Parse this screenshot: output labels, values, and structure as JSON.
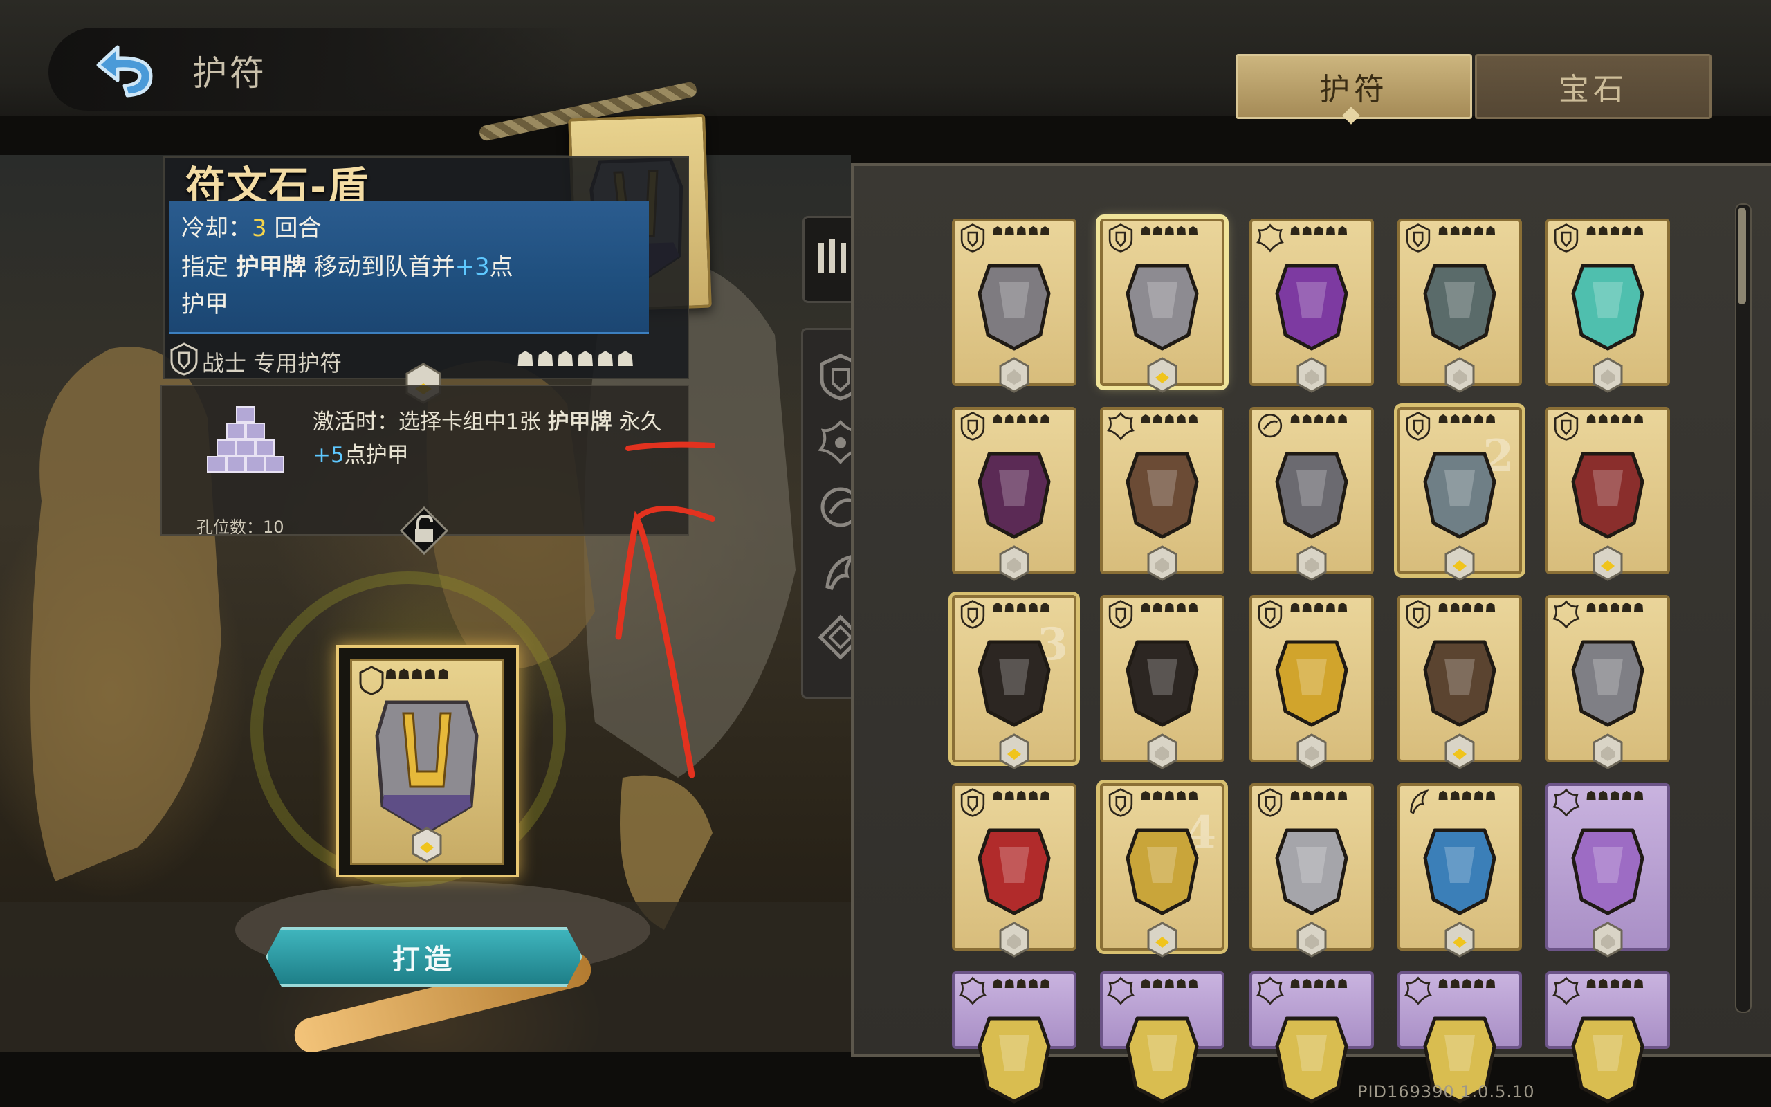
{
  "header": {
    "title": "护符",
    "tabs": [
      {
        "label": "护符",
        "active": true
      },
      {
        "label": "宝石",
        "active": false
      }
    ]
  },
  "detail": {
    "name": "符文石-盾",
    "cooldown_prefix": "冷却：",
    "cooldown_value": "3",
    "cooldown_suffix": "回合",
    "effect_line1_a": "指定",
    "effect_line1_b": "护甲牌",
    "effect_line1_c": "移动到队首并",
    "effect_line1_d": "+3",
    "effect_line1_e": "点",
    "effect_line2": "护甲",
    "class_label": "战士 专用护符",
    "rank_stars": "☗☗☗☗☗☗",
    "slot_text1_a": "激活时：选择卡组中1张",
    "slot_text1_b": "护甲牌",
    "slot_text1_c": "永久",
    "slot_text2_a": "+5",
    "slot_text2_b": "点护甲",
    "slot_count": "孔位数：10"
  },
  "forge": {
    "button_label": "打造",
    "card_stars": "☗☗☗☗☗"
  },
  "filters": [
    "sort",
    "warrior",
    "mage",
    "rogue",
    "poet",
    "hunter"
  ],
  "grid": {
    "card_stars": "☗☗☗☗☗",
    "cards": [
      {
        "name": "stone-shield-charm",
        "class": "warrior",
        "style": "gold"
      },
      {
        "name": "runestone-shield",
        "class": "warrior",
        "style": "gold",
        "selected": true,
        "gem": true
      },
      {
        "name": "purple-chain-charm",
        "class": "mage",
        "style": "gold"
      },
      {
        "name": "chain-pendant",
        "class": "warrior",
        "style": "gold"
      },
      {
        "name": "crystal-lantern",
        "class": "warrior",
        "style": "gold"
      },
      {
        "name": "red-crystal-cloak",
        "class": "warrior",
        "style": "gold"
      },
      {
        "name": "clockwork-orb",
        "class": "mage",
        "style": "gold"
      },
      {
        "name": "eye-automaton",
        "class": "rogue",
        "style": "gold"
      },
      {
        "name": "gauntlet-hook",
        "class": "warrior",
        "style": "gold",
        "badge": "2",
        "gem": true,
        "highlight": true
      },
      {
        "name": "red-armor-gauntlet",
        "class": "warrior",
        "style": "gold",
        "gem": true
      },
      {
        "name": "war-banner",
        "class": "warrior",
        "style": "gold",
        "badge": "3",
        "gem": true,
        "highlight": true
      },
      {
        "name": "war-banner-2",
        "class": "warrior",
        "style": "gold"
      },
      {
        "name": "gold-cube-arm",
        "class": "warrior",
        "style": "gold"
      },
      {
        "name": "leather-tome",
        "class": "warrior",
        "style": "gold",
        "gem": true
      },
      {
        "name": "steel-hammer",
        "class": "mage",
        "style": "gold"
      },
      {
        "name": "ruby-ring",
        "class": "warrior",
        "style": "gold"
      },
      {
        "name": "golden-amulet",
        "class": "warrior",
        "style": "gold",
        "badge": "4",
        "gem": true,
        "highlight": true
      },
      {
        "name": "steel-gauntlet",
        "class": "warrior",
        "style": "gold"
      },
      {
        "name": "vortex-tome",
        "class": "poet",
        "style": "gold",
        "gem": true
      },
      {
        "name": "violet-mirror",
        "class": "mage",
        "style": "purple"
      },
      {
        "name": "clover-shield",
        "class": "mage",
        "style": "purple"
      },
      {
        "name": "clover-shield-2",
        "class": "mage",
        "style": "purple"
      },
      {
        "name": "clover-shield-3",
        "class": "mage",
        "style": "purple"
      },
      {
        "name": "clover-shield-4",
        "class": "mage",
        "style": "purple"
      },
      {
        "name": "clover-shield-5",
        "class": "mage",
        "style": "purple"
      }
    ]
  },
  "version": "PID169390  1.0.5.10"
}
